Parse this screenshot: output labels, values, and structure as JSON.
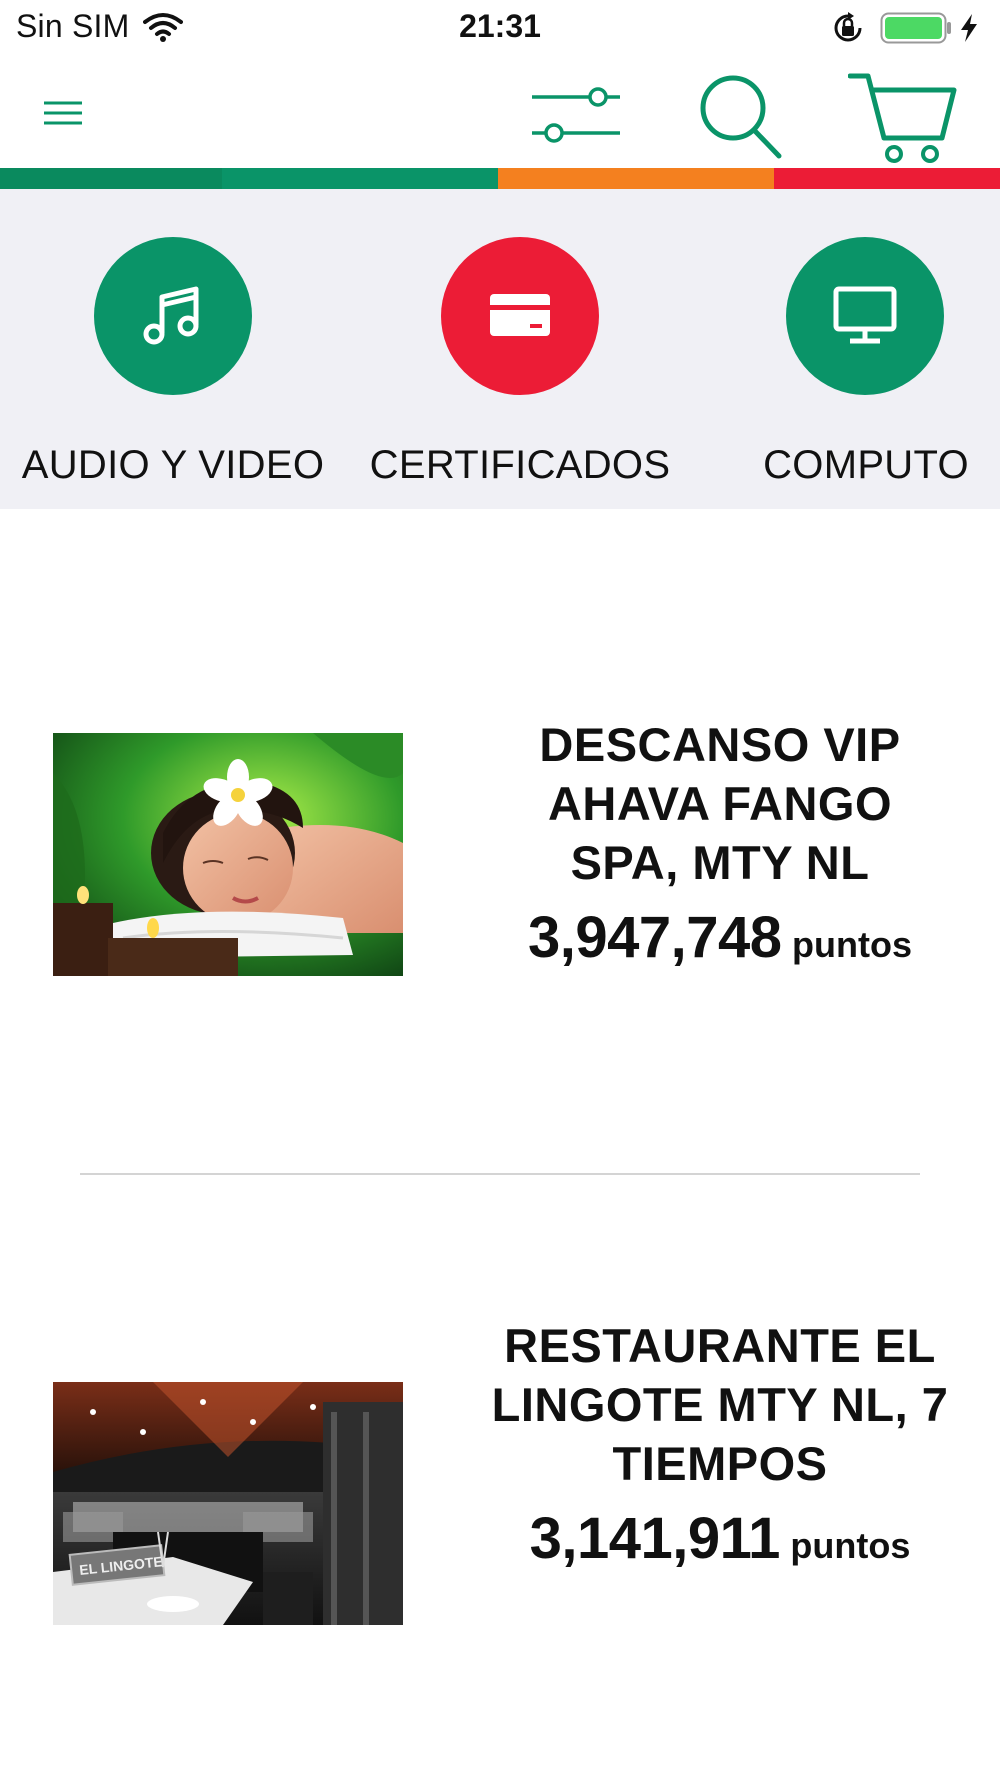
{
  "status_bar": {
    "carrier": "Sin SIM",
    "time": "21:31",
    "battery_color": "#4cd964"
  },
  "nav": {
    "menu_icon": "hamburger-menu-icon",
    "filter_icon": "filter-sliders-icon",
    "search_icon": "search-icon",
    "cart_icon": "shopping-cart-icon",
    "icon_color": "#0a9468"
  },
  "color_bar": [
    "#0a8a5e",
    "#0a9468",
    "#f4801f",
    "#ec1c36"
  ],
  "categories": [
    {
      "label": "AUDIO Y VIDEO",
      "icon": "music-note-icon",
      "color": "#0a9468"
    },
    {
      "label": "CERTIFICADOS",
      "icon": "credit-card-icon",
      "color": "#ec1c36"
    },
    {
      "label": "COMPUTO",
      "icon": "monitor-icon",
      "color": "#0a9468"
    }
  ],
  "products": [
    {
      "title": "DESCANSO VIP AHAVA FANGO SPA, MTY NL",
      "points": "3,947,748",
      "unit": "puntos",
      "image": "spa-photo"
    },
    {
      "title": "RESTAURANTE EL LINGOTE MTY NL, 7 TIEMPOS",
      "points": "3,141,911",
      "unit": "puntos",
      "image": "restaurant-photo"
    }
  ],
  "restaurant_sign_text": "EL LINGOTE"
}
